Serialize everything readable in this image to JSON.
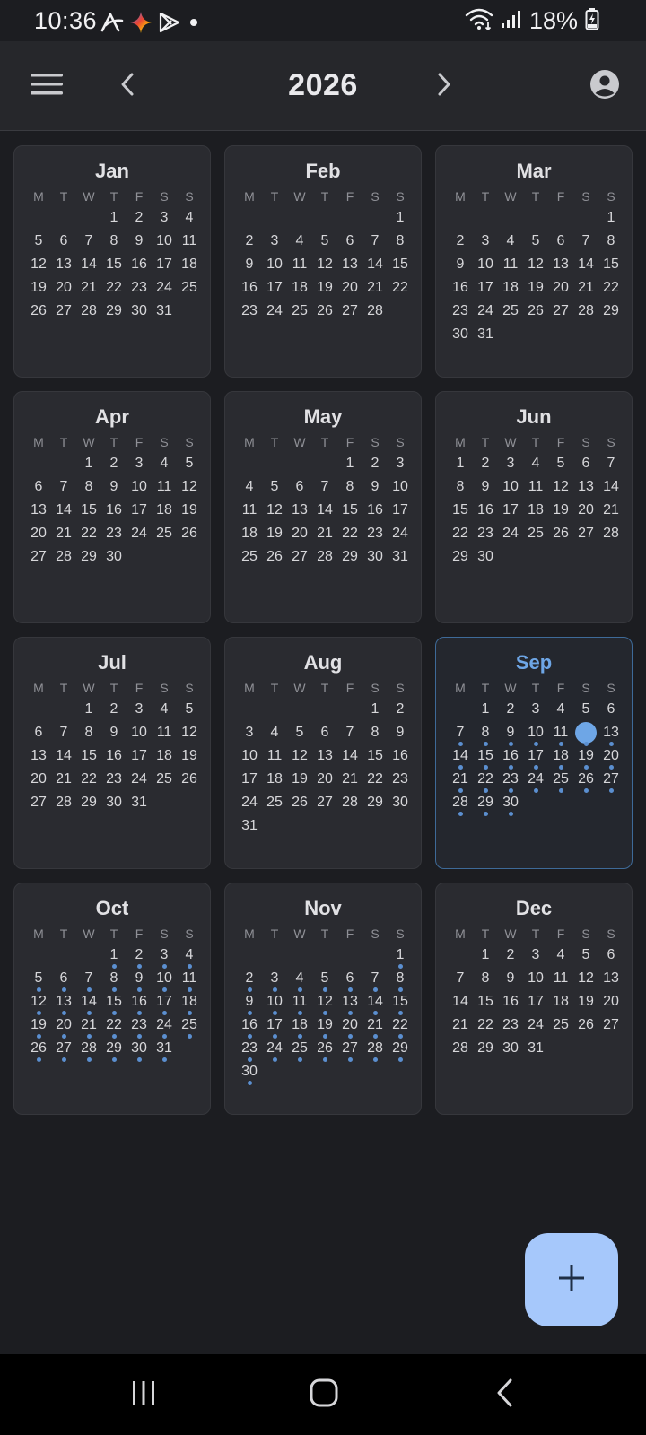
{
  "status_bar": {
    "time": "10:36",
    "battery": "18%",
    "icons": [
      "a-arrow-icon",
      "gemini-sparkle-icon",
      "play-store-icon",
      "dot-icon",
      "wifi-icon",
      "signal-icon",
      "battery-charging-icon"
    ]
  },
  "app_bar": {
    "year": "2026",
    "menu_icon": "menu-icon",
    "prev_icon": "chevron-left-icon",
    "next_icon": "chevron-right-icon",
    "account_icon": "account-circle-icon"
  },
  "weekdays": [
    "M",
    "T",
    "W",
    "T",
    "F",
    "S",
    "S"
  ],
  "colors": {
    "accent": "#6ea6e6",
    "event_dot": "#5b8fd0",
    "fab": "#a6c8fb",
    "card": "#2a2b30",
    "background": "#1c1d21"
  },
  "months": [
    {
      "name": "Jan",
      "weeks": [
        [
          "",
          "",
          "",
          "1",
          "2",
          "3",
          "4"
        ],
        [
          "5",
          "6",
          "7",
          "8",
          "9",
          "10",
          "11"
        ],
        [
          "12",
          "13",
          "14",
          "15",
          "16",
          "17",
          "18"
        ],
        [
          "19",
          "20",
          "21",
          "22",
          "23",
          "24",
          "25"
        ],
        [
          "26",
          "27",
          "28",
          "29",
          "30",
          "31",
          ""
        ]
      ]
    },
    {
      "name": "Feb",
      "weeks": [
        [
          "",
          "",
          "",
          "",
          "",
          "",
          "1"
        ],
        [
          "2",
          "3",
          "4",
          "5",
          "6",
          "7",
          "8"
        ],
        [
          "9",
          "10",
          "11",
          "12",
          "13",
          "14",
          "15"
        ],
        [
          "16",
          "17",
          "18",
          "19",
          "20",
          "21",
          "22"
        ],
        [
          "23",
          "24",
          "25",
          "26",
          "27",
          "28",
          ""
        ]
      ]
    },
    {
      "name": "Mar",
      "weeks": [
        [
          "",
          "",
          "",
          "",
          "",
          "",
          "1"
        ],
        [
          "2",
          "3",
          "4",
          "5",
          "6",
          "7",
          "8"
        ],
        [
          "9",
          "10",
          "11",
          "12",
          "13",
          "14",
          "15"
        ],
        [
          "16",
          "17",
          "18",
          "19",
          "20",
          "21",
          "22"
        ],
        [
          "23",
          "24",
          "25",
          "26",
          "27",
          "28",
          "29"
        ],
        [
          "30",
          "31",
          "",
          "",
          "",
          "",
          ""
        ]
      ]
    },
    {
      "name": "Apr",
      "weeks": [
        [
          "",
          "",
          "1",
          "2",
          "3",
          "4",
          "5"
        ],
        [
          "6",
          "7",
          "8",
          "9",
          "10",
          "11",
          "12"
        ],
        [
          "13",
          "14",
          "15",
          "16",
          "17",
          "18",
          "19"
        ],
        [
          "20",
          "21",
          "22",
          "23",
          "24",
          "25",
          "26"
        ],
        [
          "27",
          "28",
          "29",
          "30",
          "",
          "",
          ""
        ]
      ]
    },
    {
      "name": "May",
      "weeks": [
        [
          "",
          "",
          "",
          "",
          "1",
          "2",
          "3"
        ],
        [
          "4",
          "5",
          "6",
          "7",
          "8",
          "9",
          "10"
        ],
        [
          "11",
          "12",
          "13",
          "14",
          "15",
          "16",
          "17"
        ],
        [
          "18",
          "19",
          "20",
          "21",
          "22",
          "23",
          "24"
        ],
        [
          "25",
          "26",
          "27",
          "28",
          "29",
          "30",
          "31"
        ]
      ]
    },
    {
      "name": "Jun",
      "weeks": [
        [
          "1",
          "2",
          "3",
          "4",
          "5",
          "6",
          "7"
        ],
        [
          "8",
          "9",
          "10",
          "11",
          "12",
          "13",
          "14"
        ],
        [
          "15",
          "16",
          "17",
          "18",
          "19",
          "20",
          "21"
        ],
        [
          "22",
          "23",
          "24",
          "25",
          "26",
          "27",
          "28"
        ],
        [
          "29",
          "30",
          "",
          "",
          "",
          "",
          ""
        ]
      ]
    },
    {
      "name": "Jul",
      "weeks": [
        [
          "",
          "",
          "1",
          "2",
          "3",
          "4",
          "5"
        ],
        [
          "6",
          "7",
          "8",
          "9",
          "10",
          "11",
          "12"
        ],
        [
          "13",
          "14",
          "15",
          "16",
          "17",
          "18",
          "19"
        ],
        [
          "20",
          "21",
          "22",
          "23",
          "24",
          "25",
          "26"
        ],
        [
          "27",
          "28",
          "29",
          "30",
          "31",
          "",
          ""
        ]
      ]
    },
    {
      "name": "Aug",
      "weeks": [
        [
          "",
          "",
          "",
          "",
          "",
          "1",
          "2"
        ],
        [
          "3",
          "4",
          "5",
          "6",
          "7",
          "8",
          "9"
        ],
        [
          "10",
          "11",
          "12",
          "13",
          "14",
          "15",
          "16"
        ],
        [
          "17",
          "18",
          "19",
          "20",
          "21",
          "22",
          "23"
        ],
        [
          "24",
          "25",
          "26",
          "27",
          "28",
          "29",
          "30"
        ],
        [
          "31",
          "",
          "",
          "",
          "",
          "",
          ""
        ]
      ]
    },
    {
      "name": "Sep",
      "current": true,
      "today": "12",
      "dots_from": 7,
      "weeks": [
        [
          "",
          "1",
          "2",
          "3",
          "4",
          "5",
          "6"
        ],
        [
          "7",
          "8",
          "9",
          "10",
          "11",
          "12",
          "13"
        ],
        [
          "14",
          "15",
          "16",
          "17",
          "18",
          "19",
          "20"
        ],
        [
          "21",
          "22",
          "23",
          "24",
          "25",
          "26",
          "27"
        ],
        [
          "28",
          "29",
          "30",
          "",
          "",
          "",
          ""
        ]
      ]
    },
    {
      "name": "Oct",
      "dots_from": 1,
      "weeks": [
        [
          "",
          "",
          "",
          "1",
          "2",
          "3",
          "4"
        ],
        [
          "5",
          "6",
          "7",
          "8",
          "9",
          "10",
          "11"
        ],
        [
          "12",
          "13",
          "14",
          "15",
          "16",
          "17",
          "18"
        ],
        [
          "19",
          "20",
          "21",
          "22",
          "23",
          "24",
          "25"
        ],
        [
          "26",
          "27",
          "28",
          "29",
          "30",
          "31",
          ""
        ]
      ]
    },
    {
      "name": "Nov",
      "dots_from": 1,
      "weeks": [
        [
          "",
          "",
          "",
          "",
          "",
          "",
          "1"
        ],
        [
          "2",
          "3",
          "4",
          "5",
          "6",
          "7",
          "8"
        ],
        [
          "9",
          "10",
          "11",
          "12",
          "13",
          "14",
          "15"
        ],
        [
          "16",
          "17",
          "18",
          "19",
          "20",
          "21",
          "22"
        ],
        [
          "23",
          "24",
          "25",
          "26",
          "27",
          "28",
          "29"
        ],
        [
          "30",
          "",
          "",
          "",
          "",
          "",
          ""
        ]
      ]
    },
    {
      "name": "Dec",
      "weeks": [
        [
          "",
          "1",
          "2",
          "3",
          "4",
          "5",
          "6"
        ],
        [
          "7",
          "8",
          "9",
          "10",
          "11",
          "12",
          "13"
        ],
        [
          "14",
          "15",
          "16",
          "17",
          "18",
          "19",
          "20"
        ],
        [
          "21",
          "22",
          "23",
          "24",
          "25",
          "26",
          "27"
        ],
        [
          "28",
          "29",
          "30",
          "31",
          "",
          "",
          ""
        ]
      ]
    }
  ],
  "fab": {
    "icon": "plus-icon"
  },
  "nav_bar": {
    "icons": [
      "recent-apps-icon",
      "home-icon",
      "back-icon"
    ]
  }
}
